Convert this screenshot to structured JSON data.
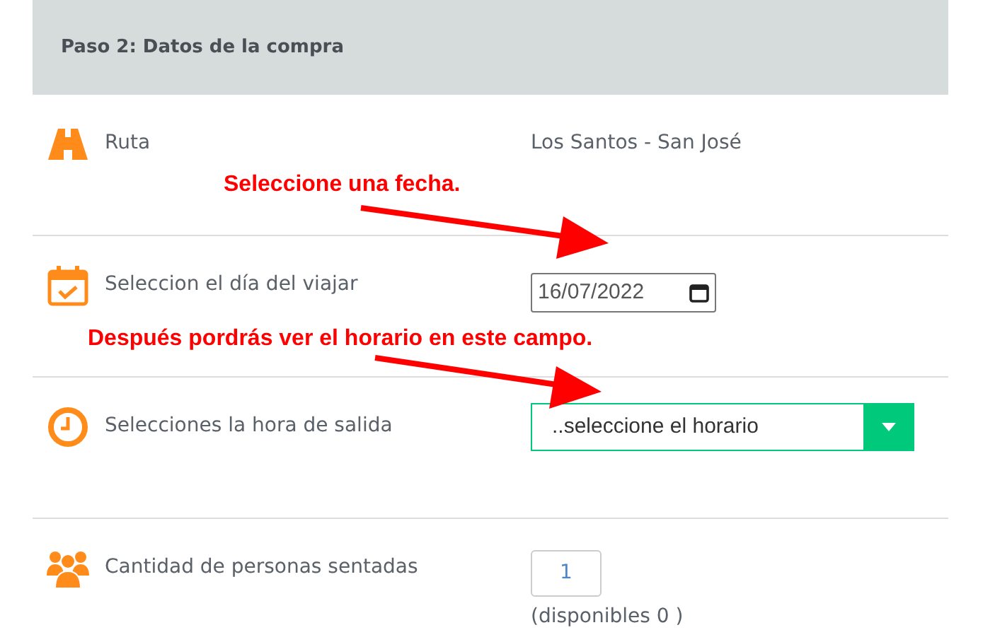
{
  "panel": {
    "title": "Paso 2: Datos de la compra"
  },
  "rows": [
    {
      "kind": "text",
      "label": "Ruta",
      "value": "Los Santos - San José"
    },
    {
      "kind": "date",
      "label": "Seleccion el día del viajar",
      "value": "16/07/2022"
    },
    {
      "kind": "select",
      "label": "Selecciones la hora de salida",
      "value": "..seleccione el horario"
    },
    {
      "kind": "number",
      "label": "Cantidad de personas sentadas",
      "value": "1",
      "note": "(disponibles 0 )"
    }
  ],
  "annotations": [
    {
      "text": "Seleccione una fecha."
    },
    {
      "text": "Después pordrás ver el horario en este campo."
    }
  ]
}
